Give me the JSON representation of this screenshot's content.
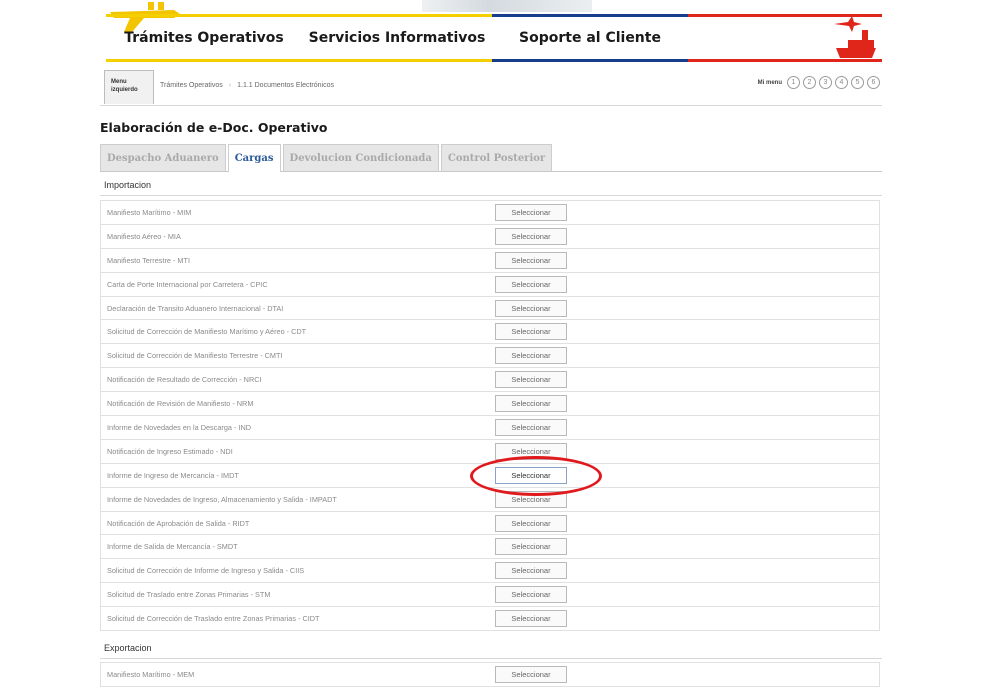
{
  "colors": {
    "yellow": "#f5d000",
    "blue": "#173d8c",
    "red": "#e0261b",
    "active_tab": "#2b5a9a",
    "annotation": "#e0191c"
  },
  "top_nav": {
    "items": [
      {
        "icon": "plane-icon",
        "label": "Trámites Operativos"
      },
      {
        "label": "Servicios Informativos"
      },
      {
        "label": "Soporte al Cliente"
      }
    ],
    "brand_icon": "ship-plane-icon"
  },
  "menu_button": {
    "line1": "Menu",
    "line2": "izquierdo"
  },
  "breadcrumb": [
    "Trámites Operativos",
    "1.1.1 Documentos Electrónicos"
  ],
  "mi_menu": {
    "label": "Mi menu",
    "slots": [
      "1",
      "2",
      "3",
      "4",
      "5",
      "6"
    ]
  },
  "page_title": "Elaboración de e-Doc. Operativo",
  "sub_tabs": [
    {
      "label": "Despacho Aduanero",
      "active": false
    },
    {
      "label": "Cargas",
      "active": true
    },
    {
      "label": "Devolucion Condicionada",
      "active": false
    },
    {
      "label": "Control Posterior",
      "active": false
    }
  ],
  "sections": {
    "importacion": {
      "title": "Importacion",
      "rows": [
        {
          "label": "Manifiesto Marítimo - MIM",
          "button": "Seleccionar"
        },
        {
          "label": "Manifiesto Aéreo - MIA",
          "button": "Seleccionar"
        },
        {
          "label": "Manifiesto Terrestre - MTI",
          "button": "Seleccionar"
        },
        {
          "label": "Carta de Porte Internacional por Carretera - CPIC",
          "button": "Seleccionar"
        },
        {
          "label": "Declaración de Transito Aduanero Internacional - DTAI",
          "button": "Seleccionar"
        },
        {
          "label": "Solicitud de Corrección de Manifiesto Marítimo y Aéreo - CDT",
          "button": "Seleccionar"
        },
        {
          "label": "Solicitud de Corrección de Manifiesto Terrestre - CMTI",
          "button": "Seleccionar"
        },
        {
          "label": "Notificación de Resultado de Corrección - NRCI",
          "button": "Seleccionar"
        },
        {
          "label": "Notificación de Revisión de Manifiesto - NRM",
          "button": "Seleccionar"
        },
        {
          "label": "Informe de Novedades en la Descarga - IND",
          "button": "Seleccionar"
        },
        {
          "label": "Notificación de Ingreso Estimado - NDI",
          "button": "Seleccionar"
        },
        {
          "label": "Informe de Ingreso de Mercancía - IMDT",
          "button": "Seleccionar",
          "highlighted": true
        },
        {
          "label": "Informe de Novedades de Ingreso, Almacenamiento y Salida - IMPADT",
          "button": "Seleccionar"
        },
        {
          "label": "Notificación de Aprobación de Salida - RIDT",
          "button": "Seleccionar"
        },
        {
          "label": "Informe de Salida de Mercancía - SMDT",
          "button": "Seleccionar"
        },
        {
          "label": "Solicitud de Corrección de Informe de Ingreso y Salida - CIIS",
          "button": "Seleccionar"
        },
        {
          "label": "Solicitud de Traslado entre Zonas Primarias - STM",
          "button": "Seleccionar"
        },
        {
          "label": "Solicitud de Corrección de Traslado entre Zonas Primarias - CIDT",
          "button": "Seleccionar"
        }
      ]
    },
    "exportacion": {
      "title": "Exportacion",
      "rows": [
        {
          "label": "Manifiesto Marítimo - MEM",
          "button": "Seleccionar"
        }
      ]
    }
  }
}
